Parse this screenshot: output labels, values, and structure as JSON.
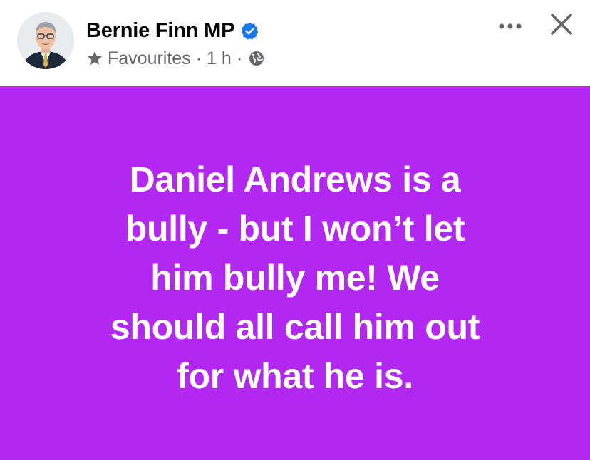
{
  "post": {
    "author": "Bernie Finn MP",
    "verified_icon": "verified-badge-icon",
    "audience_icon": "star-icon",
    "audience_label": "Favourites",
    "separator": "·",
    "time_ago": "1 h",
    "privacy_icon": "globe-icon",
    "more_icon": "more-options-icon",
    "close_icon": "close-icon",
    "colors": {
      "background": "#b228f0",
      "text": "#ffffff",
      "verified": "#1877f2",
      "meta": "#65676b"
    },
    "status_lines": [
      "Daniel Andrews is a",
      "bully - but I won’t let",
      "him bully me! We",
      "should all call him out",
      "for what he is."
    ]
  }
}
